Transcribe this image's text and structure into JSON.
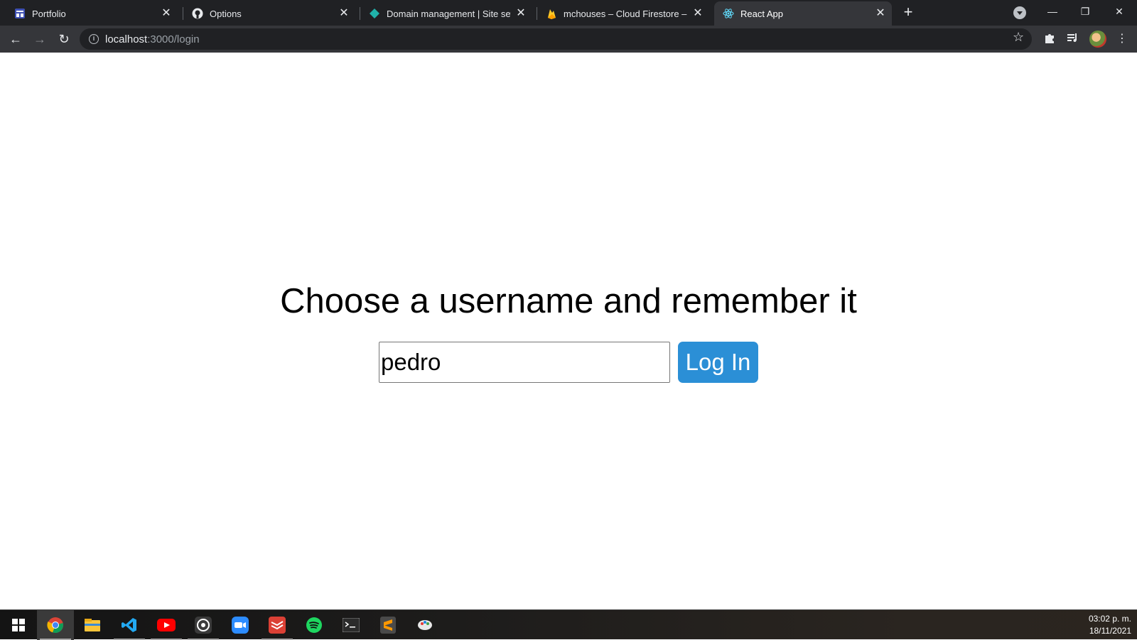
{
  "browser": {
    "tabs": [
      {
        "title": "Portfolio",
        "icon": "portfolio-icon",
        "active": false
      },
      {
        "title": "Options",
        "icon": "github-icon",
        "active": false
      },
      {
        "title": "Domain management | Site settin",
        "icon": "netlify-icon",
        "active": false
      },
      {
        "title": "mchouses – Cloud Firestore – Fir",
        "icon": "firebase-icon",
        "active": false
      },
      {
        "title": "React App",
        "icon": "react-icon",
        "active": true
      }
    ],
    "new_tab_label": "+",
    "url_host": "localhost",
    "url_path": ":3000/login"
  },
  "page": {
    "heading": "Choose a username and remember it",
    "username_value": "pedro",
    "login_label": "Log In"
  },
  "taskbar": {
    "apps": [
      "windows-start-icon",
      "chrome-icon",
      "file-explorer-icon",
      "vscode-icon",
      "youtube-icon",
      "whatsapp-icon",
      "zoom-icon",
      "todoist-icon",
      "spotify-icon",
      "terminal-icon",
      "sublime-text-icon",
      "paint-icon"
    ],
    "time": "03:02 p. m.",
    "date": "18/11/2021"
  },
  "colors": {
    "tabstrip": "#202124",
    "toolbar": "#35363a",
    "login_button": "#2b8fd6"
  }
}
